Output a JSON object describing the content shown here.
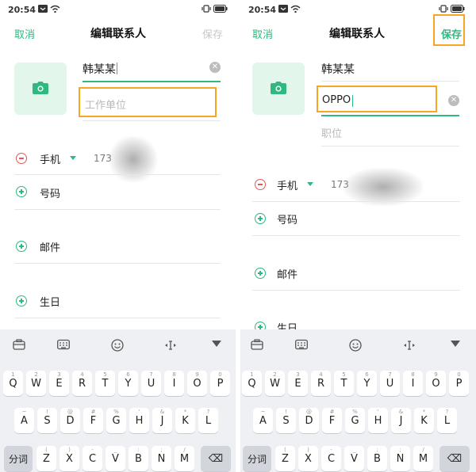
{
  "left": {
    "status": {
      "time": "20:54"
    },
    "nav": {
      "cancel": "取消",
      "title": "编辑联系人",
      "save": "保存"
    },
    "name_value": "韩某某",
    "clear_icon": "✕",
    "company_placeholder": "工作单位",
    "rows": {
      "phone_label": "手机",
      "phone_partial": "173",
      "number_label": "号码",
      "email_label": "邮件",
      "birthday_label": "生日"
    }
  },
  "right": {
    "status": {
      "time": "20:54"
    },
    "nav": {
      "cancel": "取消",
      "title": "编辑联系人",
      "save": "保存"
    },
    "name_value": "韩某某",
    "company_value": "OPPO",
    "clear_icon": "✕",
    "position_placeholder": "职位",
    "rows": {
      "phone_label": "手机",
      "phone_partial": "173",
      "number_label": "号码",
      "email_label": "邮件",
      "birthday_label": "生日"
    }
  },
  "keyboard": {
    "toolbar_icons": [
      "briefcase-icon",
      "keyboard-icon",
      "emoji-icon",
      "cursor-move-icon",
      "collapse-icon"
    ],
    "row1": [
      {
        "k": "Q",
        "s": "1"
      },
      {
        "k": "W",
        "s": "2"
      },
      {
        "k": "E",
        "s": "3"
      },
      {
        "k": "R",
        "s": "4"
      },
      {
        "k": "T",
        "s": "5"
      },
      {
        "k": "Y",
        "s": "6"
      },
      {
        "k": "U",
        "s": "7"
      },
      {
        "k": "I",
        "s": "8"
      },
      {
        "k": "O",
        "s": "9"
      },
      {
        "k": "P",
        "s": "0"
      }
    ],
    "row2": [
      {
        "k": "A",
        "s": "~"
      },
      {
        "k": "S",
        "s": "!"
      },
      {
        "k": "D",
        "s": "@"
      },
      {
        "k": "F",
        "s": "#"
      },
      {
        "k": "G",
        "s": "%"
      },
      {
        "k": "H",
        "s": "'"
      },
      {
        "k": "J",
        "s": "&"
      },
      {
        "k": "K",
        "s": "*"
      },
      {
        "k": "L",
        "s": "?"
      }
    ],
    "row3": [
      {
        "k": "Z",
        "s": "("
      },
      {
        "k": "X",
        "s": ")"
      },
      {
        "k": "C",
        "s": "-"
      },
      {
        "k": "V",
        "s": "_"
      },
      {
        "k": "B",
        "s": ":"
      },
      {
        "k": "N",
        "s": ";"
      },
      {
        "k": "M",
        "s": "/"
      }
    ],
    "segment_key": "分词",
    "delete_icon": "⌫"
  }
}
